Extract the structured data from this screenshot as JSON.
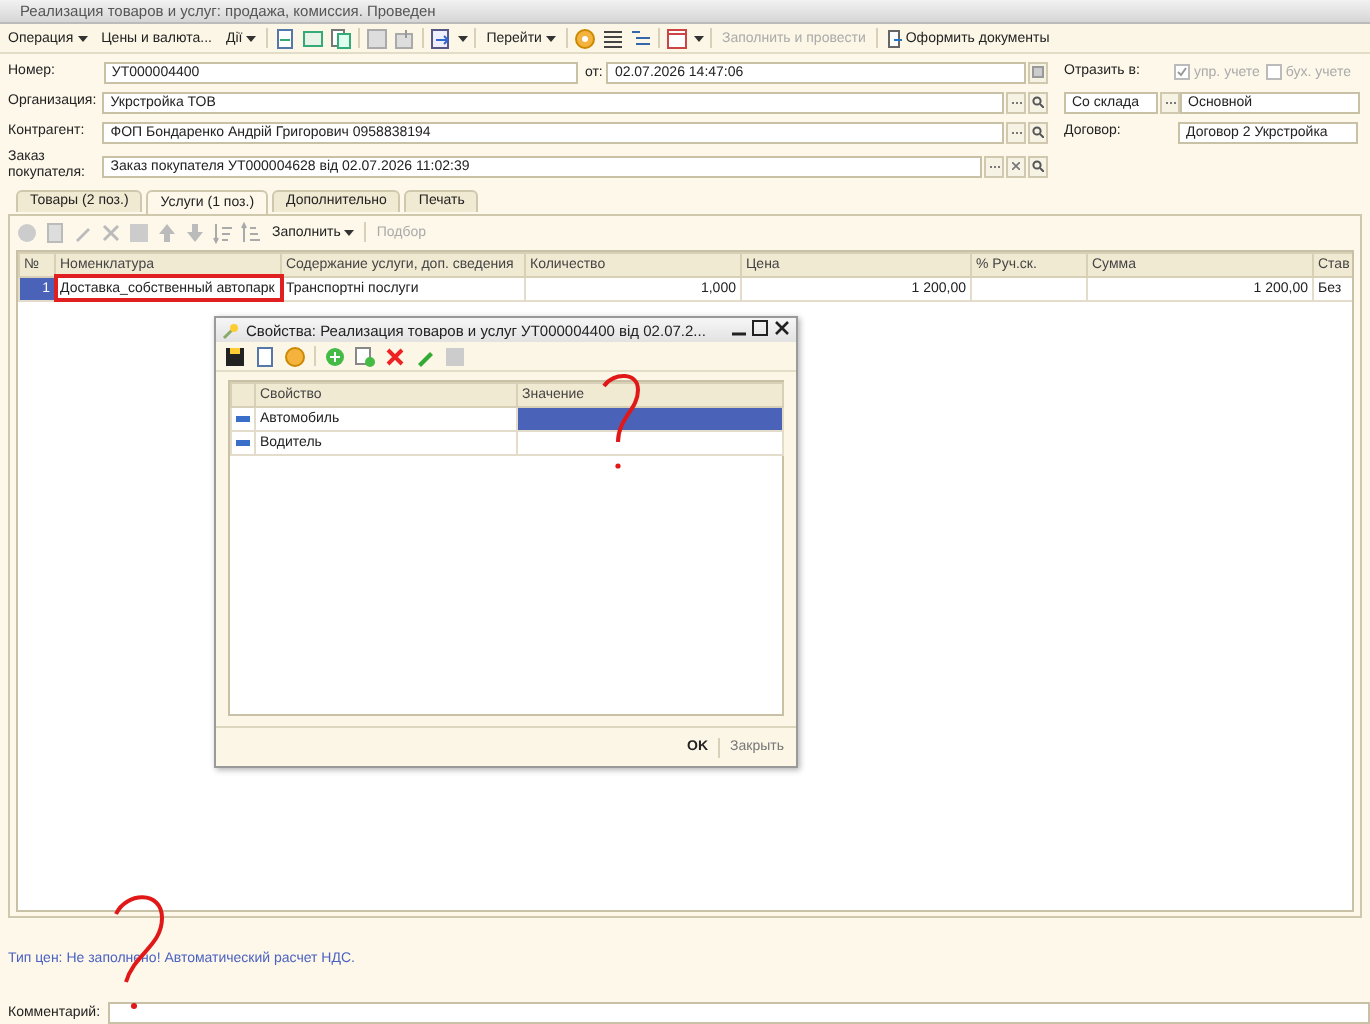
{
  "window": {
    "title": "Реализация товаров и услуг: продажа, комиссия. Проведен"
  },
  "toolbar": [
    {
      "kind": "menu",
      "label": "Операция",
      "disabled": false
    },
    {
      "kind": "button",
      "label": "Цены и валюта...",
      "disabled": false
    },
    {
      "kind": "menu",
      "label": "Дії",
      "disabled": false
    },
    {
      "kind": "menu",
      "label": "Перейти",
      "disabled": false
    },
    {
      "kind": "button",
      "label": "Заполнить и провести",
      "disabled": true
    },
    {
      "kind": "button",
      "label": "Оформить документы",
      "disabled": false
    }
  ],
  "header": {
    "number": {
      "label": "Номер:",
      "value": "УТ000004400"
    },
    "date": {
      "label": "от:",
      "value": "02.07.2026 14:47:06"
    },
    "organization": {
      "label": "Организация:",
      "value": "Укрстройка ТОВ"
    },
    "counterparty": {
      "label": "Контрагент:",
      "value": "ФОП Бондаренко Андрій Григорович 0958838194"
    },
    "order": {
      "label": "Заказ покупателя:",
      "value": "Заказ покупателя УТ000004628 від 02.07.2026 11:02:39"
    },
    "reflect": {
      "label": "Отразить в:",
      "options": [
        {
          "label": "упр. учете",
          "checked": true,
          "disabled": true
        },
        {
          "label": "бух. учете",
          "checked": false,
          "disabled": true
        }
      ]
    },
    "warehouse_type": "Со склада",
    "warehouse": "Основной",
    "contract": {
      "label": "Договор:",
      "value": "Договор 2 Укрстройка"
    }
  },
  "tabs": [
    {
      "label": "Товары (2 поз.)",
      "selected": false
    },
    {
      "label": "Услуги (1 поз.)",
      "selected": true
    },
    {
      "label": "Дополнительно",
      "selected": false
    },
    {
      "label": "Печать",
      "selected": false
    }
  ],
  "table_toolbar": [
    {
      "kind": "menu",
      "label": "Заполнить",
      "disabled": false
    },
    {
      "kind": "button",
      "label": "Подбор",
      "disabled": true
    }
  ],
  "table": {
    "columns": [
      "№",
      "Номенклатура",
      "Содержание услуги, доп. сведения",
      "Количество",
      "Цена",
      "% Руч.ск.",
      "Сумма",
      "Став"
    ],
    "rows": [
      {
        "selected": true,
        "cells": [
          {
            "text": "1",
            "marked": false
          },
          {
            "text": "Доставка_собственный автопарк",
            "marked": true
          },
          {
            "text": "Транспортні послуги",
            "marked": false
          },
          {
            "text": "1,000",
            "marked": false
          },
          {
            "text": "1 200,00",
            "marked": false
          },
          {
            "text": "",
            "marked": false
          },
          {
            "text": "1 200,00",
            "marked": false
          },
          {
            "text": "Без",
            "marked": false
          }
        ]
      }
    ]
  },
  "status_text": "Тип цен: Не заполнено! Автоматический расчет НДС.",
  "comment": {
    "label": "Комментарий:"
  },
  "dialog": {
    "title": "Свойства: Реализация товаров и услуг УТ000004400 від 02.07.2...",
    "columns": [
      "Свойство",
      "Значение"
    ],
    "rows": [
      {
        "name": "Автомобиль",
        "selected": true
      },
      {
        "name": "Водитель",
        "selected": false
      }
    ],
    "buttons": [
      {
        "label": "OK",
        "default": true
      },
      {
        "label": "Закрыть",
        "default": false
      }
    ]
  },
  "annotations": [
    {
      "kind": "question"
    },
    {
      "kind": "question"
    }
  ]
}
